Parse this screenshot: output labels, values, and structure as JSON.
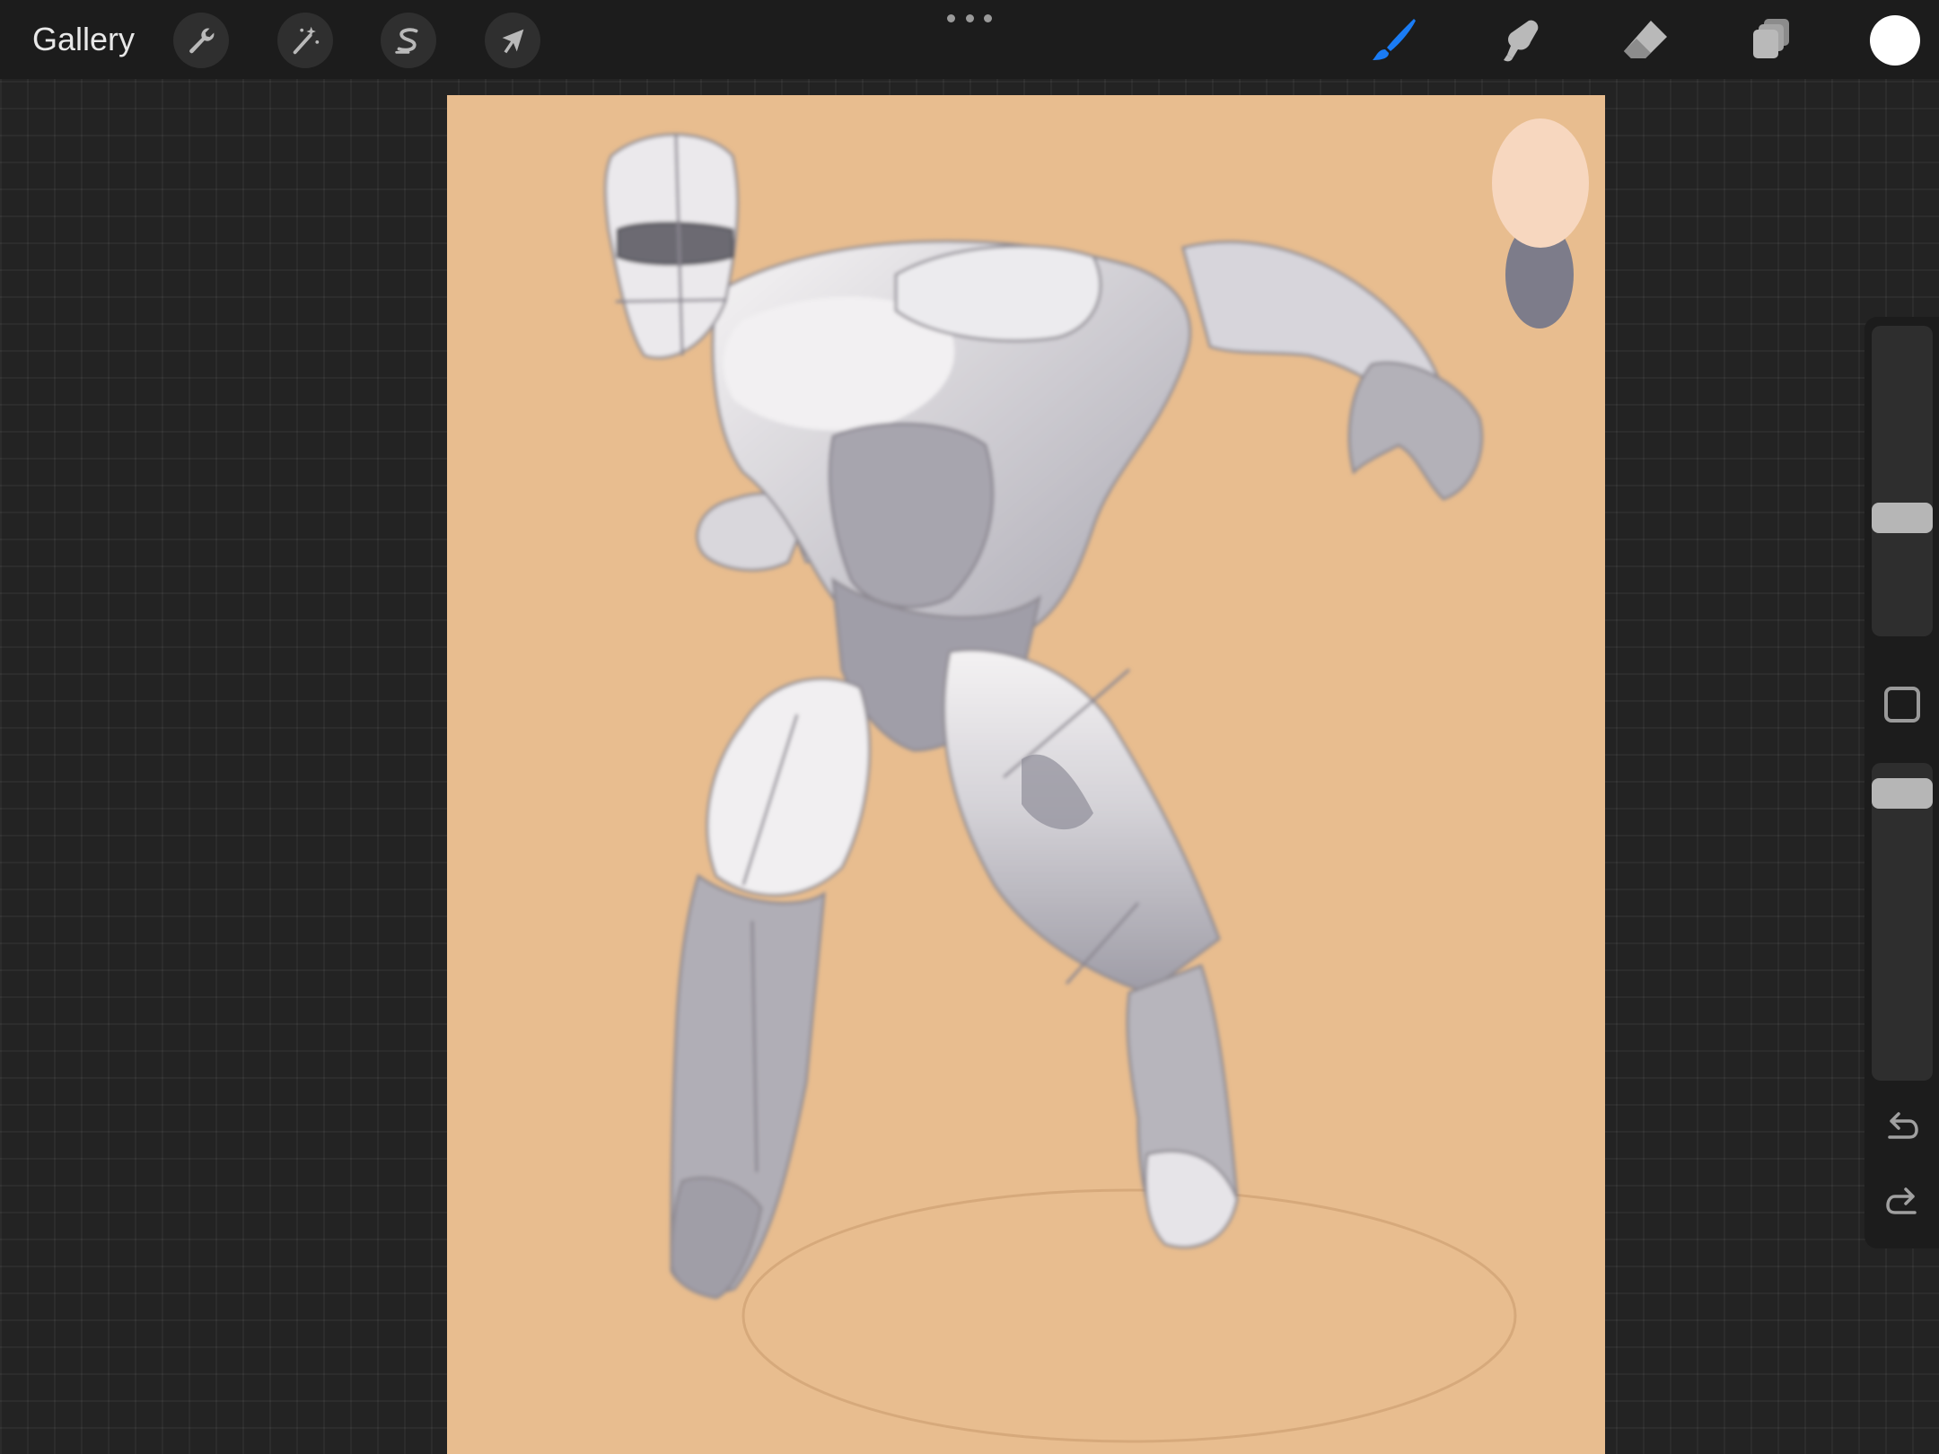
{
  "toolbar": {
    "gallery_label": "Gallery",
    "left_tools": [
      {
        "name": "actions",
        "icon": "wrench-icon"
      },
      {
        "name": "adjustments",
        "icon": "magic-wand-icon"
      },
      {
        "name": "selection",
        "icon": "selection-s-icon"
      },
      {
        "name": "transform",
        "icon": "arrow-cursor-icon"
      }
    ],
    "right_tools": [
      {
        "name": "brush",
        "icon": "brush-icon",
        "active": true
      },
      {
        "name": "smudge",
        "icon": "smudge-finger-icon",
        "active": false
      },
      {
        "name": "eraser",
        "icon": "eraser-icon",
        "active": false
      },
      {
        "name": "layers",
        "icon": "layers-icon",
        "active": false
      }
    ],
    "current_color": "#ffffff",
    "accent_color": "#1a7cf5"
  },
  "sidebar": {
    "brush_size_level": 0.6,
    "opacity_level": 0.95,
    "icons": [
      "modify-square-icon",
      "undo-icon",
      "redo-icon"
    ]
  },
  "canvas": {
    "background_color": "#e8bd8f",
    "palette_swatches": [
      "#f7d7bf",
      "#7d7c8a"
    ]
  }
}
